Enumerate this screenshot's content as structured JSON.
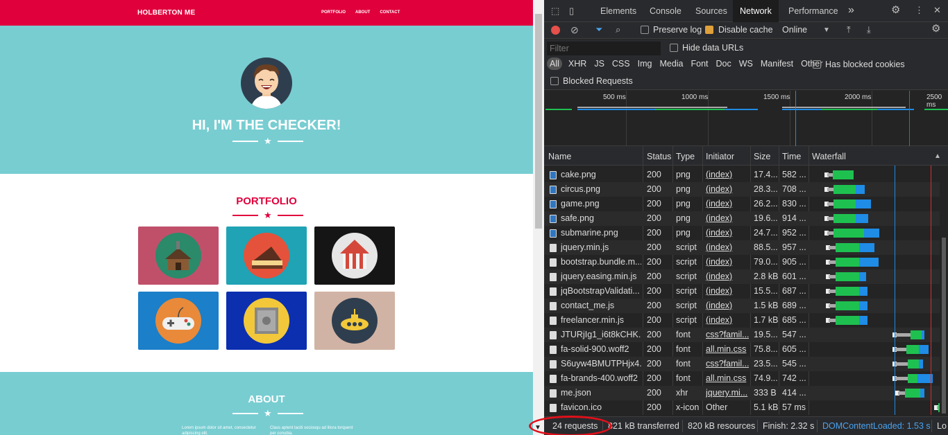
{
  "site": {
    "brand": "HOLBERTON ME",
    "nav": [
      "PORTFOLIO",
      "ABOUT",
      "CONTACT"
    ],
    "hero_title": "HI, I'M THE CHECKER!",
    "portfolio_title": "PORTFOLIO",
    "about_title": "ABOUT",
    "about_left": "Lorem ipsum dolor sit amet, consectetur adipiscing elit.",
    "about_right": "Class aptent taciti sociosqu ad litora torquent per conubia.",
    "tiles": [
      {
        "name": "cabin",
        "bg": "#c0506a",
        "disc": "#2a8a6a"
      },
      {
        "name": "cake",
        "bg": "#1fa3b5",
        "disc": "#e4523b"
      },
      {
        "name": "circus",
        "bg": "#151515",
        "disc": "#e6e6e6"
      },
      {
        "name": "game",
        "bg": "#1b7fc9",
        "disc": "#e88a3a"
      },
      {
        "name": "safe",
        "bg": "#0c2fb0",
        "disc": "#f2c83a"
      },
      {
        "name": "submarine",
        "bg": "#d0b3a4",
        "disc": "#2f3e4e"
      }
    ],
    "colors": {
      "primary": "#e0003c",
      "hero": "#78cdd1"
    }
  },
  "devtools": {
    "tabs": [
      "Elements",
      "Console",
      "Sources",
      "Network",
      "Performance"
    ],
    "active_tab": "Network",
    "more_tabs": "»",
    "toolbar": {
      "preserve_log": "Preserve log",
      "disable_cache": "Disable cache",
      "disable_cache_checked": true,
      "throttle": "Online"
    },
    "filter_placeholder": "Filter",
    "hide_data_urls": "Hide data URLs",
    "types": [
      "All",
      "XHR",
      "JS",
      "CSS",
      "Img",
      "Media",
      "Font",
      "Doc",
      "WS",
      "Manifest",
      "Other"
    ],
    "has_blocked_cookies": "Has blocked cookies",
    "blocked_requests": "Blocked Requests",
    "overview_ticks": [
      "500 ms",
      "1000 ms",
      "1500 ms",
      "2000 ms",
      "2500 ms"
    ],
    "columns": [
      "Name",
      "Status",
      "Type",
      "Initiator",
      "Size",
      "Time",
      "Waterfall"
    ],
    "requests": [
      {
        "name": "cake.png",
        "status": "200",
        "type": "png",
        "initiator": "(index)",
        "size": "17.4...",
        "time": "582 ..."
      },
      {
        "name": "circus.png",
        "status": "200",
        "type": "png",
        "initiator": "(index)",
        "size": "28.3...",
        "time": "708 ..."
      },
      {
        "name": "game.png",
        "status": "200",
        "type": "png",
        "initiator": "(index)",
        "size": "26.2...",
        "time": "830 ..."
      },
      {
        "name": "safe.png",
        "status": "200",
        "type": "png",
        "initiator": "(index)",
        "size": "19.6...",
        "time": "914 ..."
      },
      {
        "name": "submarine.png",
        "status": "200",
        "type": "png",
        "initiator": "(index)",
        "size": "24.7...",
        "time": "952 ..."
      },
      {
        "name": "jquery.min.js",
        "status": "200",
        "type": "script",
        "initiator": "(index)",
        "size": "88.5...",
        "time": "957 ..."
      },
      {
        "name": "bootstrap.bundle.m...",
        "status": "200",
        "type": "script",
        "initiator": "(index)",
        "size": "79.0...",
        "time": "905 ..."
      },
      {
        "name": "jquery.easing.min.js",
        "status": "200",
        "type": "script",
        "initiator": "(index)",
        "size": "2.8 kB",
        "time": "601 ..."
      },
      {
        "name": "jqBootstrapValidati...",
        "status": "200",
        "type": "script",
        "initiator": "(index)",
        "size": "15.5...",
        "time": "687 ..."
      },
      {
        "name": "contact_me.js",
        "status": "200",
        "type": "script",
        "initiator": "(index)",
        "size": "1.5 kB",
        "time": "689 ..."
      },
      {
        "name": "freelancer.min.js",
        "status": "200",
        "type": "script",
        "initiator": "(index)",
        "size": "1.7 kB",
        "time": "685 ..."
      },
      {
        "name": "JTURjIg1_i6t8kCHK...",
        "status": "200",
        "type": "font",
        "initiator": "css?famil...",
        "size": "19.5...",
        "time": "547 ..."
      },
      {
        "name": "fa-solid-900.woff2",
        "status": "200",
        "type": "font",
        "initiator": "all.min.css",
        "size": "75.8...",
        "time": "605 ..."
      },
      {
        "name": "S6uyw4BMUTPHjx4...",
        "status": "200",
        "type": "font",
        "initiator": "css?famil...",
        "size": "23.5...",
        "time": "545 ..."
      },
      {
        "name": "fa-brands-400.woff2",
        "status": "200",
        "type": "font",
        "initiator": "all.min.css",
        "size": "74.9...",
        "time": "742 ..."
      },
      {
        "name": "me.json",
        "status": "200",
        "type": "xhr",
        "initiator": "jquery.mi...",
        "size": "333 B",
        "time": "414 ..."
      },
      {
        "name": "favicon.ico",
        "status": "200",
        "type": "x-icon",
        "initiator": "Other",
        "size": "5.1 kB",
        "time": "57 ms"
      }
    ],
    "statusbar": {
      "requests": "24 requests",
      "transferred": "821 kB transferred",
      "resources": "820 kB resources",
      "finish": "Finish: 2.32 s",
      "dcl": "DOMContentLoaded: 1.53 s",
      "load": "Lo"
    }
  }
}
